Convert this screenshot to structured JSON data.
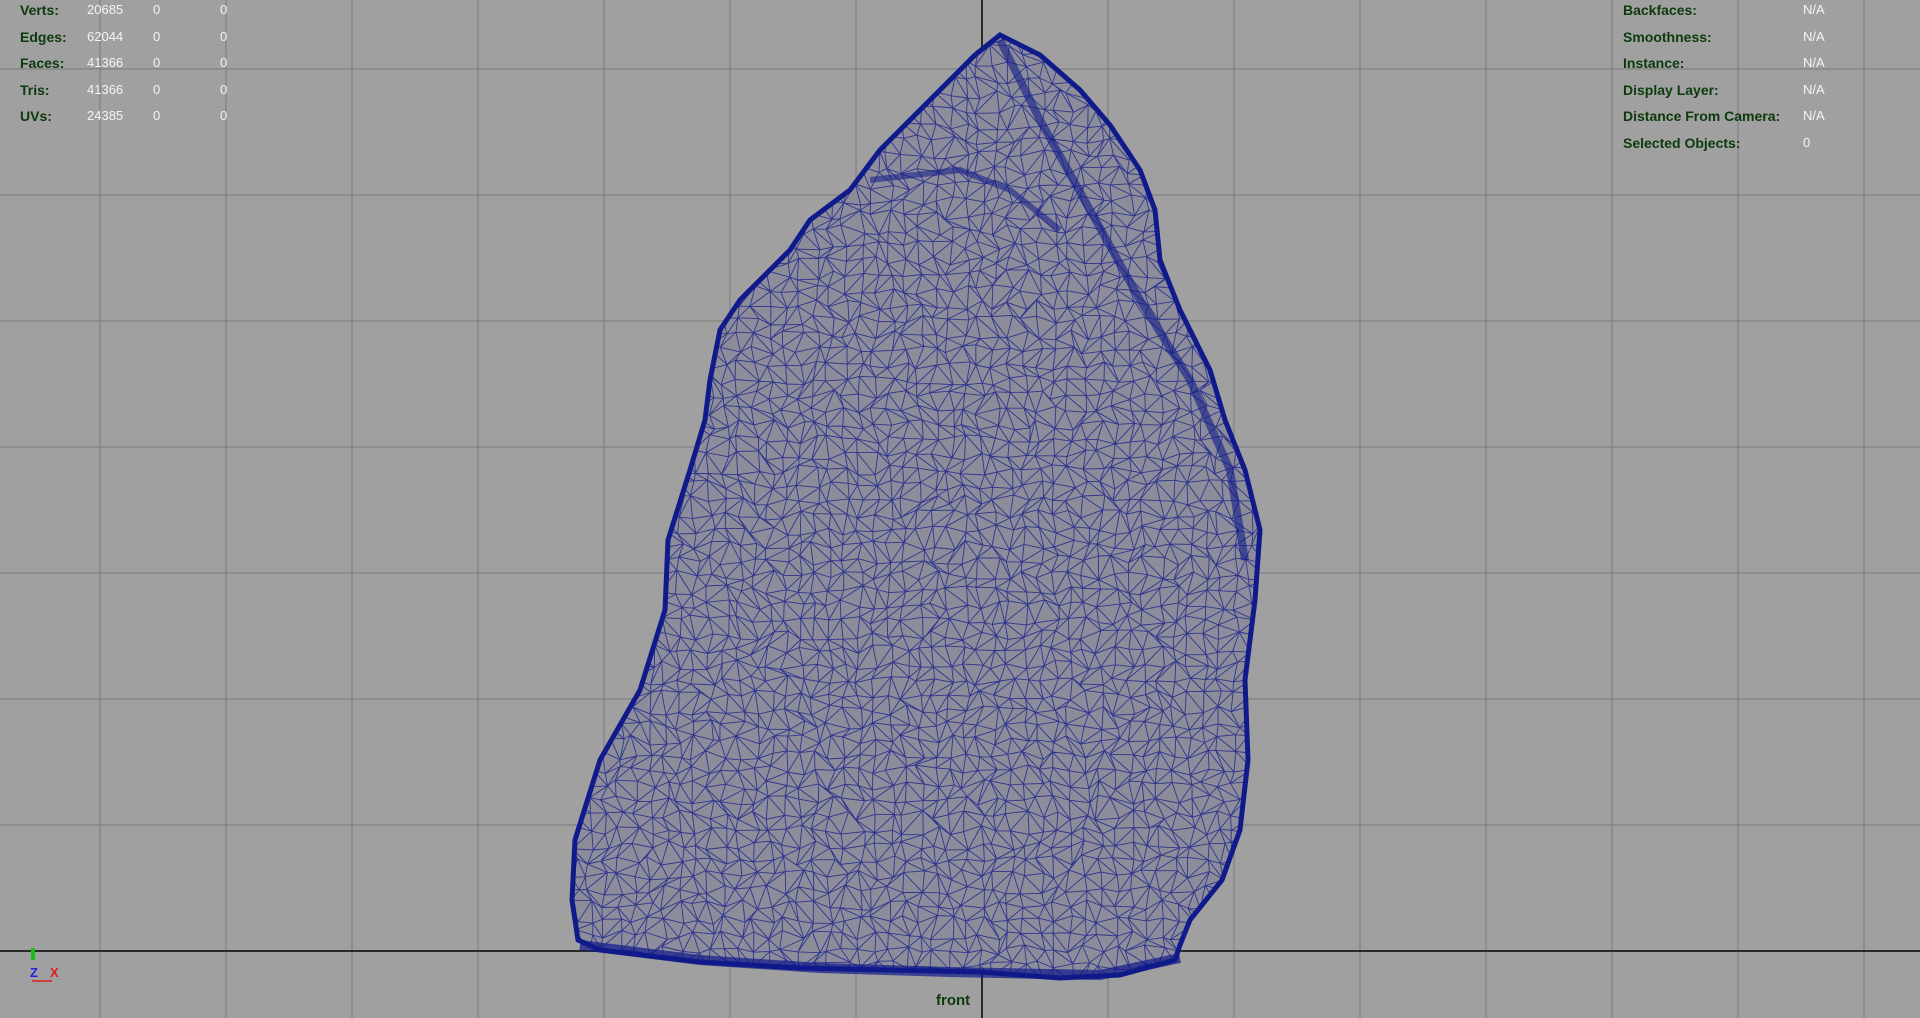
{
  "viewport": {
    "background": "#a0a0a0",
    "grid_color": "#7a7a7a",
    "axis_color": "#2a2a2a",
    "wireframe_color": "#101a8a",
    "camera_name": "front"
  },
  "hud_left": {
    "rows": [
      {
        "label": "Verts:",
        "v1": "20685",
        "v2": "0",
        "v3": "0"
      },
      {
        "label": "Edges:",
        "v1": "62044",
        "v2": "0",
        "v3": "0"
      },
      {
        "label": "Faces:",
        "v1": "41366",
        "v2": "0",
        "v3": "0"
      },
      {
        "label": "Tris:",
        "v1": "41366",
        "v2": "0",
        "v3": "0"
      },
      {
        "label": "UVs:",
        "v1": "24385",
        "v2": "0",
        "v3": "0"
      }
    ]
  },
  "hud_right": {
    "rows": [
      {
        "label": "Backfaces:",
        "value": "N/A"
      },
      {
        "label": "Smoothness:",
        "value": "N/A"
      },
      {
        "label": "Instance:",
        "value": "N/A"
      },
      {
        "label": "Display Layer:",
        "value": "N/A"
      },
      {
        "label": "Distance From Camera:",
        "value": "N/A"
      },
      {
        "label": "Selected Objects:",
        "value": "0"
      }
    ]
  },
  "axis_gizmo": {
    "y_label": "",
    "z_label": "Z",
    "x_label": "X",
    "y_color": "#16c016",
    "z_color": "#2222e0",
    "x_color": "#e01c1c"
  }
}
